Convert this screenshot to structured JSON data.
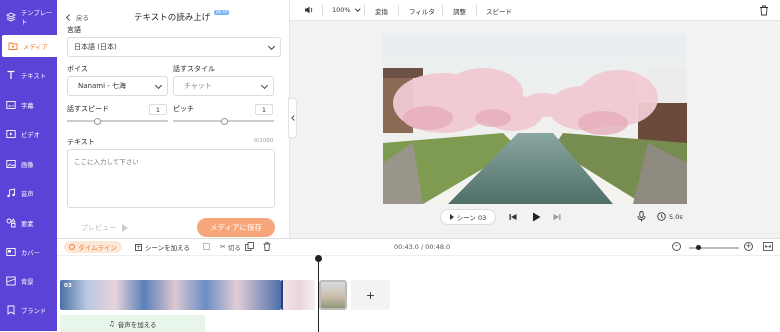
{
  "sidebar": {
    "items": [
      {
        "label": "テンプレート",
        "icon": "layers-icon"
      },
      {
        "label": "メディア",
        "icon": "folder-icon",
        "active": true
      },
      {
        "label": "テキスト",
        "icon": "text-icon"
      },
      {
        "label": "字幕",
        "icon": "subtitle-icon"
      },
      {
        "label": "ビデオ",
        "icon": "video-icon"
      },
      {
        "label": "画像",
        "icon": "image-icon"
      },
      {
        "label": "音声",
        "icon": "music-icon"
      },
      {
        "label": "要素",
        "icon": "elements-icon"
      },
      {
        "label": "カバー",
        "icon": "cover-icon"
      },
      {
        "label": "背景",
        "icon": "background-icon"
      },
      {
        "label": "ブランド",
        "icon": "brand-icon"
      }
    ]
  },
  "panel": {
    "back_label": "戻る",
    "title": "テキストの読み上げ",
    "beta": "BETA",
    "language_label": "言語",
    "language_value": "日本語 (日本)",
    "voice_label": "ボイス",
    "voice_value": "Nanami - 七海",
    "style_label": "話すスタイル",
    "style_value": "チャット",
    "speed_label": "話すスピード",
    "speed_value": "1",
    "speed_level": 0.3,
    "pitch_label": "ピッチ",
    "pitch_value": "1",
    "pitch_level": 0.5,
    "text_label": "テキスト",
    "char_count": "0/1000",
    "text_placeholder": "ここに入力して下さい",
    "preview_label": "プレビュー",
    "save_label": "メディアに保存"
  },
  "toolbar": {
    "zoom": "100%",
    "transform": "変換",
    "filter": "フィルタ",
    "adjust": "調整",
    "speed": "スピード"
  },
  "player": {
    "scene": "シーン 03",
    "duration": "5.0s"
  },
  "timeline": {
    "tab_label": "タイムライン",
    "add_scene": "シーンを加える",
    "split": "切る",
    "time": "00:43.0 / 00:48.0",
    "clip_label": "03",
    "add_audio": "音声を加える",
    "zoom_level": 0.2
  },
  "colors": {
    "brand": "#5a43d6",
    "accent": "#f07b2a",
    "save_button": "#f7a57a"
  }
}
